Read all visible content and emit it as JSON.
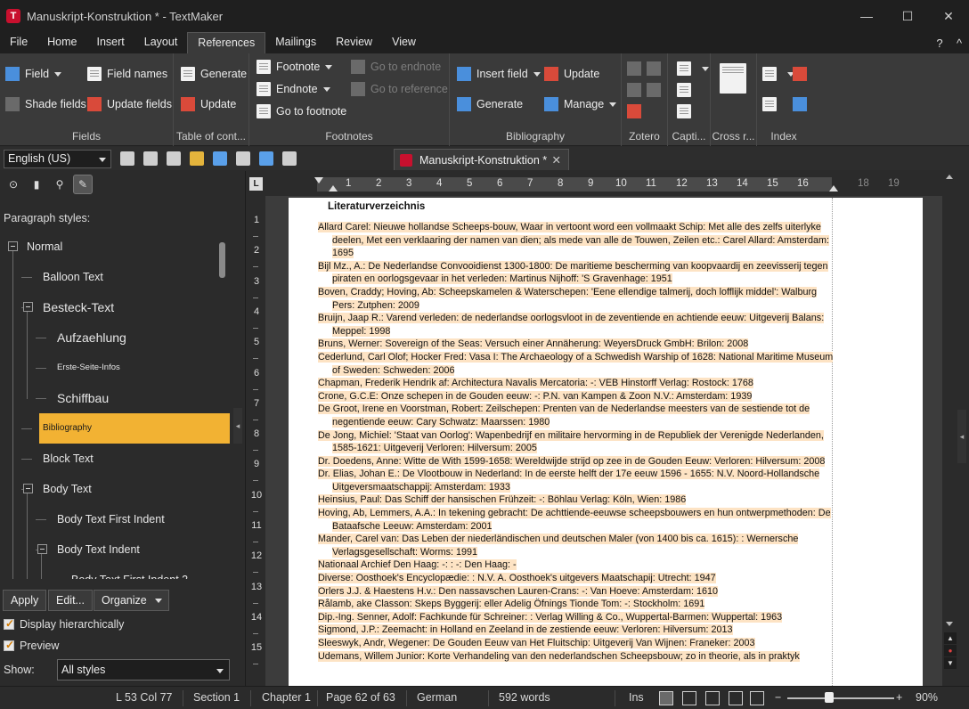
{
  "window": {
    "title": "Manuskript-Konstruktion * - TextMaker",
    "logo_letter": "T",
    "minimize": "—",
    "maximize": "☐",
    "close": "✕"
  },
  "menu": {
    "items": [
      "File",
      "Home",
      "Insert",
      "Layout",
      "References",
      "Mailings",
      "Review",
      "View"
    ],
    "active": "References",
    "help": "?",
    "collapse": "^"
  },
  "ribbon": {
    "fields": {
      "label": "Fields",
      "field": "Field",
      "field_names": "Field names",
      "shade_fields": "Shade fields",
      "update_fields": "Update fields"
    },
    "toc": {
      "label": "Table of cont...",
      "generate": "Generate",
      "update": "Update"
    },
    "footnotes": {
      "label": "Footnotes",
      "footnote": "Footnote",
      "endnote": "Endnote",
      "go_to_footnote": "Go to footnote",
      "go_to_endnote": "Go to endnote",
      "go_to_reference": "Go to reference"
    },
    "bibliography": {
      "label": "Bibliography",
      "insert_field": "Insert field",
      "generate": "Generate",
      "update": "Update",
      "manage": "Manage"
    },
    "zotero": {
      "label": "Zotero"
    },
    "captions": {
      "label": "Capti..."
    },
    "crossref": {
      "label": "Cross r..."
    },
    "index": {
      "label": "Index"
    }
  },
  "toolbar": {
    "language": "English (US)",
    "doc_tab": "Manuskript-Konstruktion *",
    "doc_tab_close": "✕"
  },
  "sidebar": {
    "paragraph_styles_label": "Paragraph styles:",
    "tree": [
      {
        "label": "Normal",
        "level": 0,
        "size": 12.5
      },
      {
        "label": "Balloon Text",
        "level": 1,
        "size": 12.5
      },
      {
        "label": "Besteck-Text",
        "level": 1,
        "size": 14
      },
      {
        "label": "Aufzaehlung",
        "level": 2,
        "size": 14
      },
      {
        "label": "Erste-Seite-Infos",
        "level": 2,
        "size": 9.5
      },
      {
        "label": "Schiffbau",
        "level": 2,
        "size": 14
      },
      {
        "label": "Bibliography",
        "level": 1,
        "size": 10,
        "selected": true
      },
      {
        "label": "Block Text",
        "level": 1,
        "size": 12.5
      },
      {
        "label": "Body Text",
        "level": 1,
        "size": 12.5
      },
      {
        "label": "Body Text First Indent",
        "level": 2,
        "size": 12.5
      },
      {
        "label": "Body Text Indent",
        "level": 2,
        "size": 12.5
      },
      {
        "label": "Body Text First Indent 2",
        "level": 3,
        "size": 12.5
      }
    ],
    "apply": "Apply",
    "edit": "Edit...",
    "organize": "Organize",
    "display_hierarchically": "Display hierarchically",
    "preview": "Preview",
    "show_label": "Show:",
    "show_value": "All styles"
  },
  "ruler": {
    "h_numbers": [
      "1",
      "2",
      "3",
      "4",
      "5",
      "6",
      "7",
      "8",
      "9",
      "10",
      "11",
      "12",
      "13",
      "14",
      "15",
      "16"
    ],
    "h_numbers_out": [
      "18",
      "19"
    ],
    "v_numbers": [
      "1",
      "2",
      "3",
      "4",
      "5",
      "6",
      "7",
      "8",
      "9",
      "10",
      "11",
      "12",
      "13",
      "14",
      "15"
    ],
    "corner": "L"
  },
  "document": {
    "heading": "Literaturverzeichnis",
    "entries": [
      "Allard Carel: Nieuwe hollandse Scheeps-bouw, Waar in vertoont word een vollmaakt Schip: Met alle des zelfs uiterlyke deelen, Met een verklaaring der namen van dien; als mede van alle de Touwen, Zeilen etc.: Carel Allard: Amsterdam: 1695",
      "Bijl Mz., A.: De Nederlandse Convooidienst 1300-1800: De maritieme bescherming van koopvaardij en zeevisserij tegen piraten en oorlogsgevaar in het verleden: Martinus Nijhoff: 'S Gravenhage: 1951",
      "Boven, Craddy; Hoving, Ab: Scheepskamelen & Waterschepen: 'Eene ellendige talmerij, doch lofflijk middel': Walburg Pers: Zutphen: 2009",
      "Bruijn, Jaap R.: Varend verleden: de nederlandse oorlogsvloot in de zeventiende en achtiende eeuw: Uitgeverij Balans: Meppel: 1998",
      "Bruns, Werner: Sovereign of the Seas: Versuch einer Annäherung: WeyersDruck GmbH: Brilon: 2008",
      "Cederlund, Carl Olof; Hocker Fred: Vasa I: The Archaeology of a Schwedish Warship of 1628: National Maritime Museum of Sweden: Schweden: 2006",
      "Chapman, Frederik Hendrik af: Architectura Navalis Mercatoria: -: VEB Hinstorff Verlag: Rostock: 1768",
      "Crone, G.C.E: Onze schepen in de Gouden eeuw: -: P.N. van Kampen & Zoon N.V.: Amsterdam: 1939",
      "De Groot, Irene en Voorstman, Robert: Zeilschepen: Prenten van de Nederlandse meesters van de sestiende tot de negentiende eeuw: Cary Schwatz: Maarssen: 1980",
      "De Jong, Michiel: 'Staat van Oorlog': Wapenbedrijf en militaire hervorming in de Republiek der Verenigde Nederlanden, 1585-1621: Uitgeverij Verloren: Hilversum: 2005",
      "Dr. Doedens, Anne: Witte de With 1599-1658: Wereldwijde strijd op zee in de Gouden Eeuw: Verloren: Hilversum: 2008",
      "Dr. Elias, Johan E.: De Vlootbouw in Nederland: In de eerste helft der 17e eeuw 1596 - 1655: N.V. Noord-Hollandsche Uitgeversmaatschappij: Amsterdam: 1933",
      "Heinsius, Paul: Das Schiff der hansischen Frühzeit: -: Böhlau Verlag: Köln, Wien: 1986",
      "Hoving, Ab, Lemmers, A.A.: In tekening gebracht: De achttiende-eeuwse scheepsbouwers en hun ontwerpmethoden: De Bataafsche Leeuw: Amsterdam: 2001",
      "Mander, Carel van: Das Leben der niederländischen und deutschen Maler (von 1400 bis ca. 1615): : Wernersche Verlagsgesellschaft: Worms: 1991",
      "Nationaal Archief Den Haag: -: : -: Den Haag: -",
      "Diverse: Oosthoek's Encyclopædie: : N.V. A. Oosthoek's uitgevers Maatschapij: Utrecht: 1947",
      "Orlers J.J. & Haestens H.v.: Den nassavschen Lauren-Crans: -: Van Hoeve: Amsterdam: 1610",
      "Rålamb, ake Classon: Skeps Byggerij: eller Adelig Öfnings Tionde Tom: -: Stockholm: 1691",
      "Dip.-Ing. Senner, Adolf: Fachkunde für Schreiner: : Verlag Willing & Co., Wuppertal-Barmen: Wuppertal: 1963",
      "Sigmond, J.P.: Zeemacht: in Holland en Zeeland in de zestiende eeuw: Verloren: Hilversum: 2013",
      "Sleeswyk, Andr, Wegener: De Gouden Eeuw van Het Fluitschip: Uitgeverij Van Wijnen: Franeker: 2003",
      "Udemans, Willem Junior: Korte Verhandeling van den nederlandschen Scheepsbouw; zo in theorie, als in praktyk"
    ]
  },
  "status": {
    "position": "L 53 Col 77",
    "section": "Section 1",
    "chapter": "Chapter 1",
    "page": "Page 62 of 63",
    "language": "German",
    "words": "592 words",
    "mode": "Ins",
    "zoom": "90%",
    "zoom_minus": "−",
    "zoom_plus": "+"
  }
}
